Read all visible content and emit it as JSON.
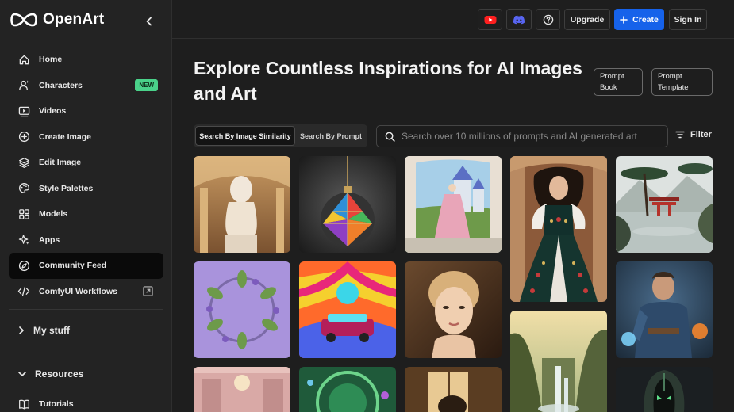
{
  "brand": {
    "name": "OpenArt"
  },
  "sidebar": {
    "items": [
      {
        "label": "Home",
        "icon": "home-icon"
      },
      {
        "label": "Characters",
        "icon": "characters-icon",
        "badge": "NEW"
      },
      {
        "label": "Videos",
        "icon": "video-icon"
      },
      {
        "label": "Create Image",
        "icon": "plus-circle-icon"
      },
      {
        "label": "Edit Image",
        "icon": "layers-icon"
      },
      {
        "label": "Style Palettes",
        "icon": "palette-icon"
      },
      {
        "label": "Models",
        "icon": "grid-icon"
      },
      {
        "label": "Apps",
        "icon": "sparkle-icon"
      },
      {
        "label": "Community Feed",
        "icon": "compass-icon",
        "active": true
      },
      {
        "label": "ComfyUI Workflows",
        "icon": "code-icon"
      }
    ],
    "my_stuff": "My stuff",
    "resources": "Resources",
    "tutorials": "Tutorials"
  },
  "topbar": {
    "upgrade": "Upgrade",
    "create": "Create",
    "sign_in": "Sign In"
  },
  "main": {
    "title": "Explore Countless Inspirations for AI Images and Art",
    "prompt_book": "Prompt Book",
    "prompt_template": "Prompt Template",
    "search_tabs": [
      "Search By Image Similarity",
      "Search By Prompt"
    ],
    "search_placeholder": "Search over 10 millions of prompts and AI generated art",
    "filter": "Filter"
  },
  "colors": {
    "accent": "#1662ea",
    "badge": "#4ad28a",
    "background": "#1e1e1e",
    "sidebar": "#232323"
  }
}
